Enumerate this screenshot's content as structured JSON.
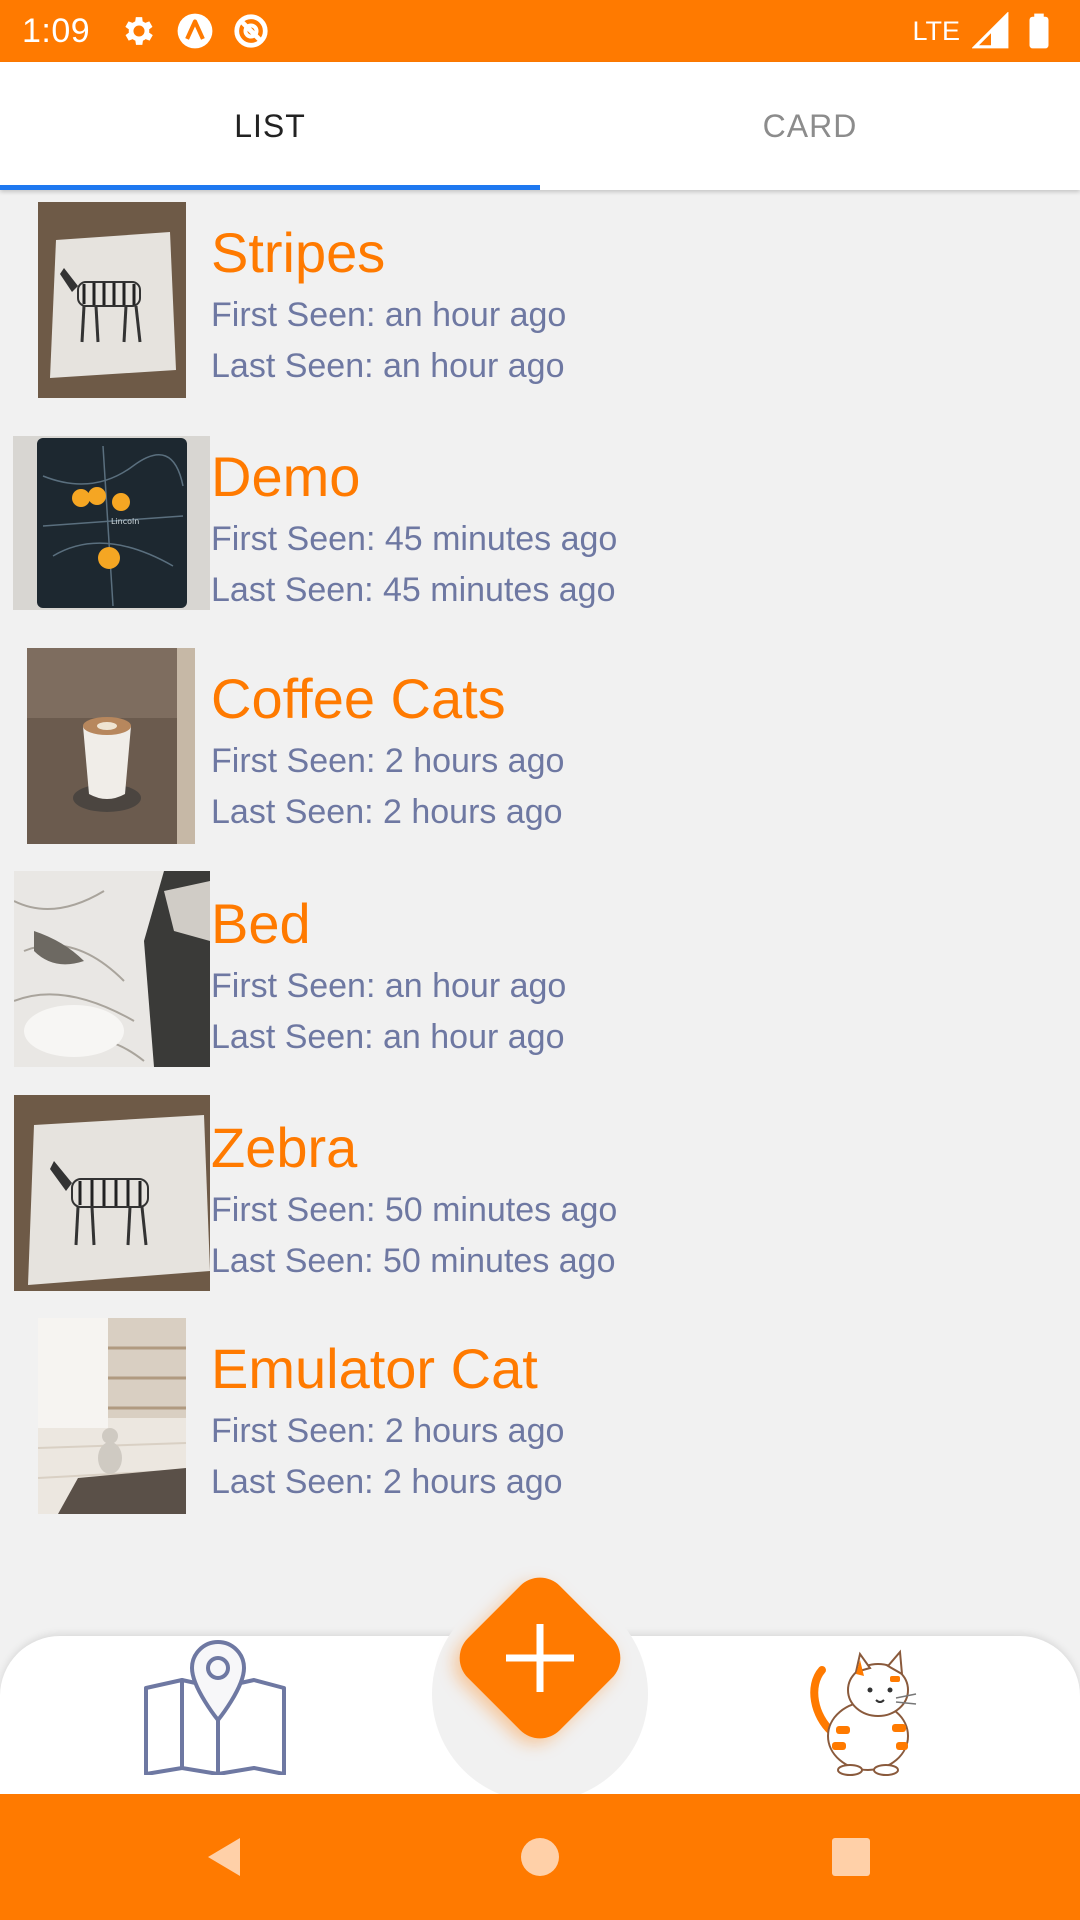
{
  "status_bar": {
    "time": "1:09",
    "network": "LTE",
    "icons": [
      "settings-icon",
      "a-letter-icon",
      "no-sync-icon",
      "signal-icon",
      "battery-icon"
    ]
  },
  "tabs": [
    {
      "label": "LIST",
      "selected": true
    },
    {
      "label": "CARD",
      "selected": false
    }
  ],
  "items": [
    {
      "title": "Stripes",
      "first_seen": "First Seen: an hour ago",
      "last_seen": "Last Seen: an hour ago",
      "thumb": "zebra-art"
    },
    {
      "title": "Demo",
      "first_seen": "First Seen: 45 minutes ago",
      "last_seen": "Last Seen: 45 minutes ago",
      "thumb": "map-phone"
    },
    {
      "title": "Coffee Cats",
      "first_seen": "First Seen: 2 hours ago",
      "last_seen": "Last Seen: 2 hours ago",
      "thumb": "coffee-cup"
    },
    {
      "title": "Bed",
      "first_seen": "First Seen: an hour ago",
      "last_seen": "Last Seen: an hour ago",
      "thumb": "bed"
    },
    {
      "title": "Zebra",
      "first_seen": "First Seen: 50 minutes ago",
      "last_seen": "Last Seen: 50 minutes ago",
      "thumb": "zebra-art"
    },
    {
      "title": "Emulator Cat",
      "first_seen": "First Seen: 2 hours ago",
      "last_seen": "Last Seen: 2 hours ago",
      "thumb": "room-cat"
    }
  ],
  "bottom_nav": {
    "left_icon": "map-icon",
    "fab_icon": "plus-icon",
    "right_icon": "cat-mascot-icon"
  },
  "colors": {
    "accent": "#ff7a00",
    "tab_indicator": "#1e78f0",
    "subtitle": "#6e78a2",
    "background": "#f1f1f1"
  }
}
